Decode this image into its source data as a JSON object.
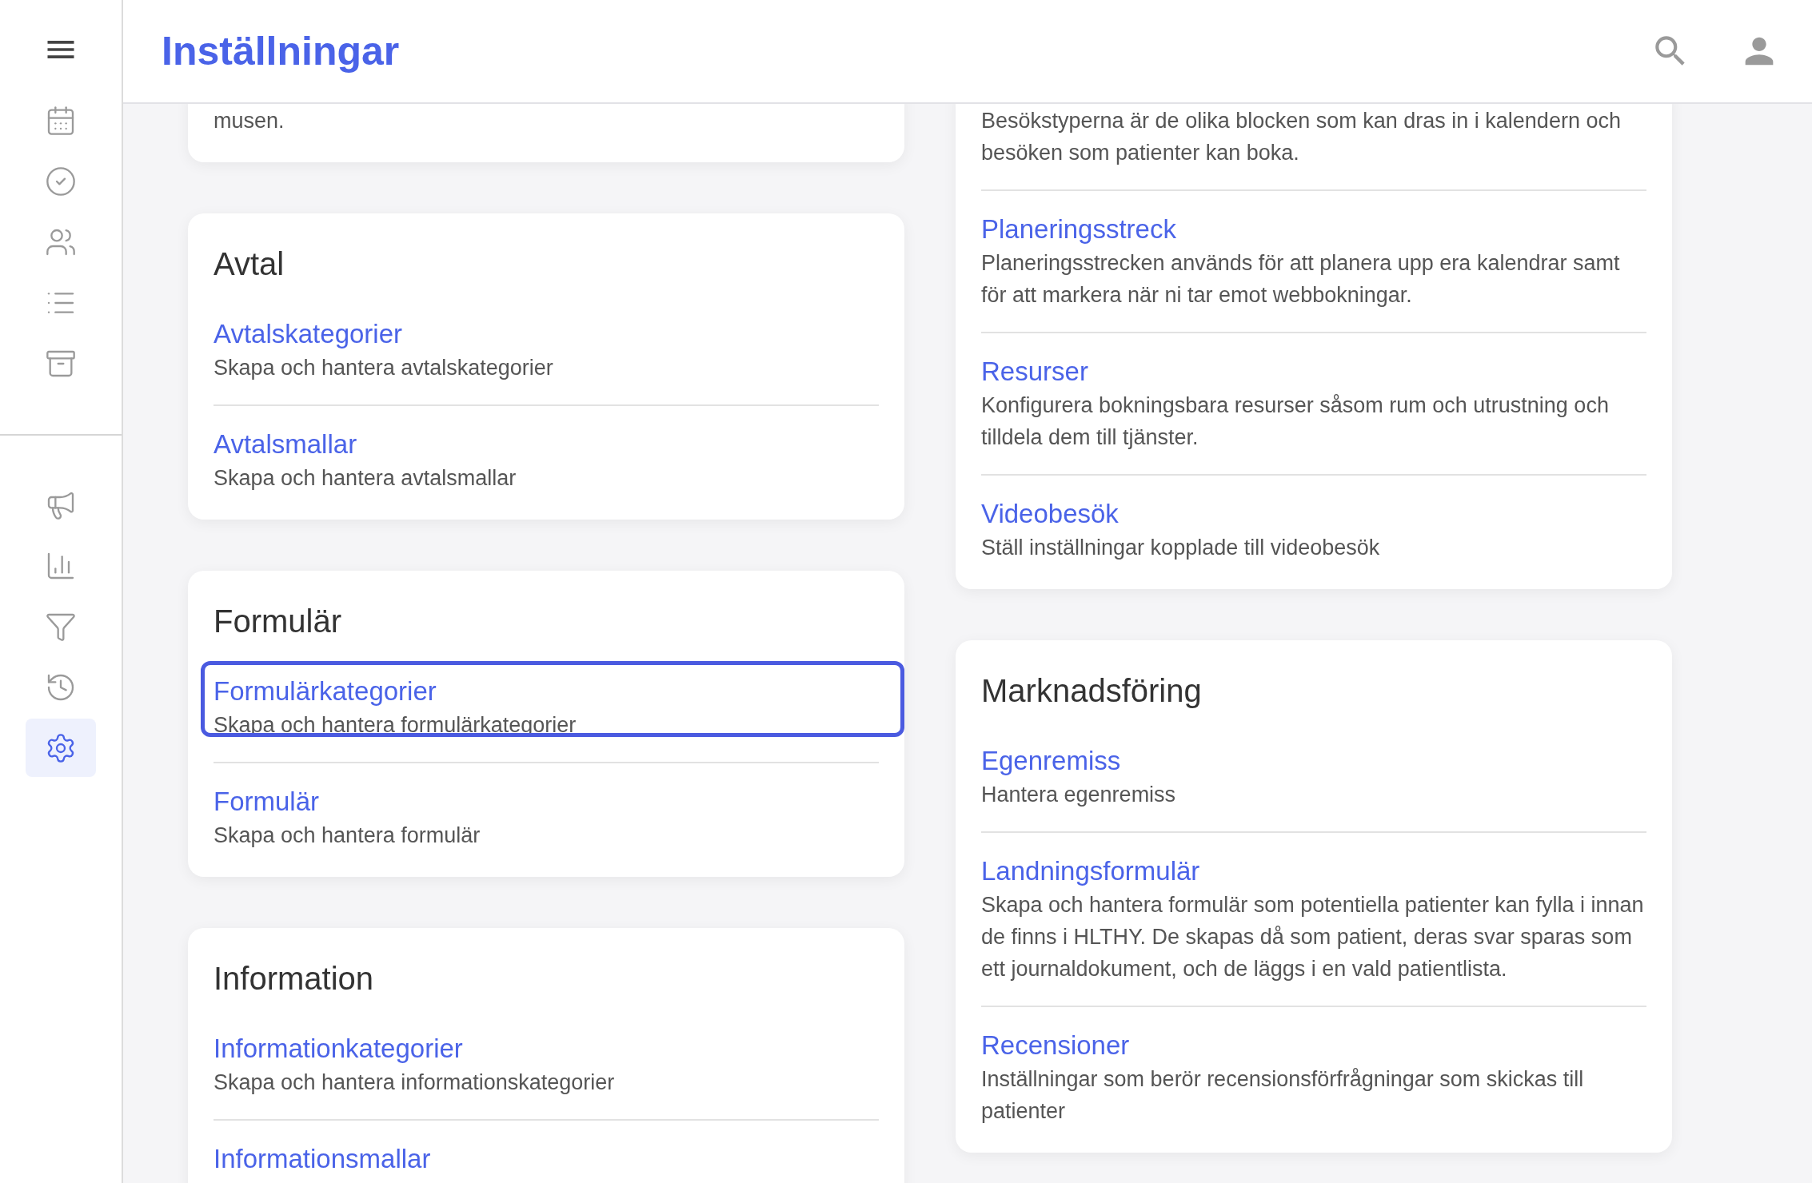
{
  "header": {
    "title": "Inställningar"
  },
  "sidebar": {
    "top_items": [
      {
        "selected": false
      },
      {
        "selected": false
      },
      {
        "selected": false
      },
      {
        "selected": false
      },
      {
        "selected": false
      }
    ],
    "bottom_items": [
      {
        "selected": false
      },
      {
        "selected": false
      },
      {
        "selected": false
      },
      {
        "selected": false
      },
      {
        "selected": true
      }
    ]
  },
  "columns": [
    {
      "cards": [
        {
          "items": [
            {
              "description": "musen."
            }
          ]
        },
        {
          "title": "Avtal",
          "items": [
            {
              "link": "Avtalskategorier",
              "description": "Skapa och hantera avtalskategorier",
              "focused": false
            },
            {
              "link": "Avtalsmallar",
              "description": "Skapa och hantera avtalsmallar",
              "focused": false
            }
          ]
        },
        {
          "title": "Formulär",
          "items": [
            {
              "link": "Formulärkategorier",
              "description": "Skapa och hantera formulärkategorier",
              "focused": true
            },
            {
              "link": "Formulär",
              "description": "Skapa och hantera formulär",
              "focused": false
            }
          ]
        },
        {
          "title": "Information",
          "items": [
            {
              "link": "Informationkategorier",
              "description": "Skapa och hantera informationskategorier",
              "focused": false
            },
            {
              "link": "Informationsmallar",
              "focused": false
            }
          ]
        }
      ]
    },
    {
      "cards": [
        {
          "items": [
            {
              "description": "Besökstyperna är de olika blocken som kan dras in i kalendern och besöken som patienter kan boka."
            },
            {
              "link": "Planeringsstreck",
              "description": "Planeringsstrecken används för att planera upp era kalendrar samt för att markera när ni tar emot webbokningar.",
              "focused": false
            },
            {
              "link": "Resurser",
              "description": "Konfigurera bokningsbara resurser såsom rum och utrustning och tilldela dem till tjänster.",
              "focused": false
            },
            {
              "link": "Videobesök",
              "description": "Ställ inställningar kopplade till videobesök",
              "focused": false
            }
          ]
        },
        {
          "title": "Marknadsföring",
          "items": [
            {
              "link": "Egenremiss",
              "description": "Hantera egenremiss",
              "focused": false
            },
            {
              "link": "Landningsformulär",
              "description": "Skapa och hantera formulär som potentiella patienter kan fylla i innan de finns i HLTHY. De skapas då som patient, deras svar sparas som ett journaldokument, och de läggs i en vald patientlista.",
              "focused": false
            },
            {
              "link": "Recensioner",
              "description": "Inställningar som berör recensionsförfrågningar som skickas till patienter",
              "focused": false
            }
          ]
        }
      ]
    }
  ]
}
